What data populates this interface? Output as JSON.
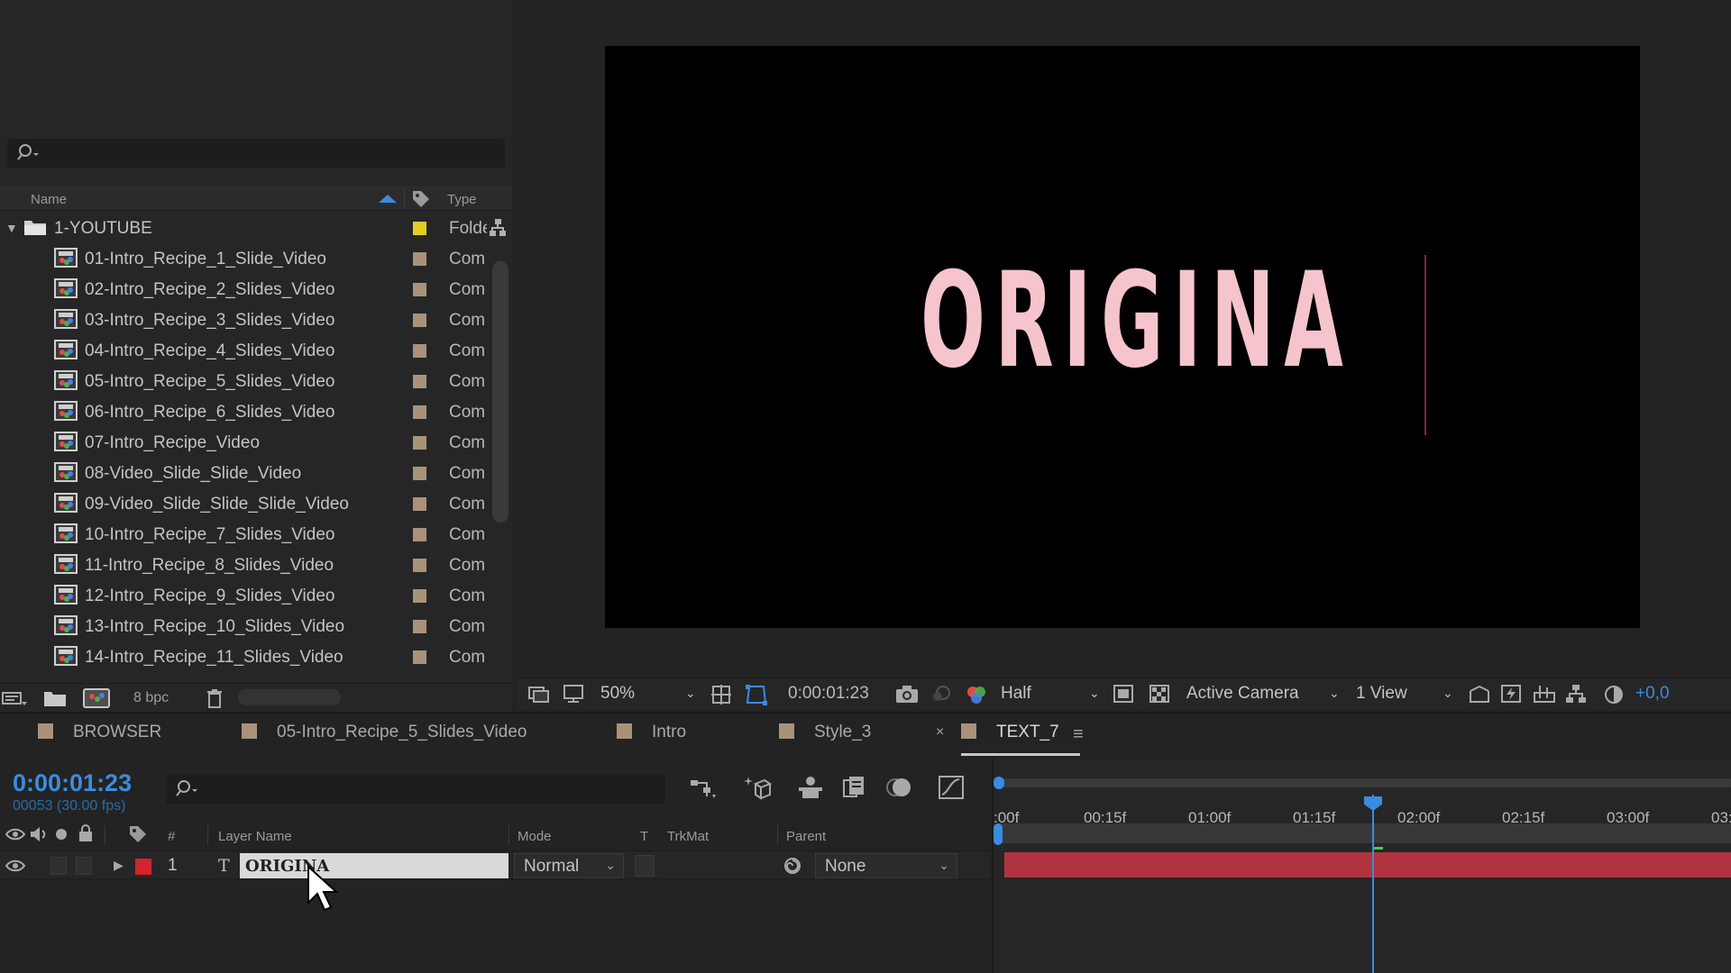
{
  "project": {
    "search_placeholder": "",
    "columns": {
      "name": "Name",
      "type": "Type"
    },
    "folder": {
      "name": "1-YOUTUBE",
      "type": "Folde"
    },
    "items": [
      {
        "name": "01-Intro_Recipe_1_Slide_Video",
        "type": "Com"
      },
      {
        "name": "02-Intro_Recipe_2_Slides_Video",
        "type": "Com"
      },
      {
        "name": "03-Intro_Recipe_3_Slides_Video",
        "type": "Com"
      },
      {
        "name": "04-Intro_Recipe_4_Slides_Video",
        "type": "Com"
      },
      {
        "name": "05-Intro_Recipe_5_Slides_Video",
        "type": "Com"
      },
      {
        "name": "06-Intro_Recipe_6_Slides_Video",
        "type": "Com"
      },
      {
        "name": "07-Intro_Recipe_Video",
        "type": "Com"
      },
      {
        "name": "08-Video_Slide_Slide_Video",
        "type": "Com"
      },
      {
        "name": "09-Video_Slide_Slide_Slide_Video",
        "type": "Com"
      },
      {
        "name": "10-Intro_Recipe_7_Slides_Video",
        "type": "Com"
      },
      {
        "name": "11-Intro_Recipe_8_Slides_Video",
        "type": "Com"
      },
      {
        "name": "12-Intro_Recipe_9_Slides_Video",
        "type": "Com"
      },
      {
        "name": "13-Intro_Recipe_10_Slides_Video",
        "type": "Com"
      },
      {
        "name": "14-Intro_Recipe_11_Slides_Video",
        "type": "Com"
      }
    ],
    "footer": {
      "bpc": "8 bpc"
    }
  },
  "viewer": {
    "canvas_text": "ORIGINA",
    "zoom": "50%",
    "timecode": "0:00:01:23",
    "resolution": "Half",
    "camera": "Active Camera",
    "views": "1 View",
    "exposure": "+0,0"
  },
  "tabs": [
    {
      "label": "BROWSER",
      "active": false
    },
    {
      "label": "05-Intro_Recipe_5_Slides_Video",
      "active": false
    },
    {
      "label": "Intro",
      "active": false
    },
    {
      "label": "Style_3",
      "active": false
    },
    {
      "label": "TEXT_7",
      "active": true
    }
  ],
  "timeline": {
    "current_time": "0:00:01:23",
    "frame_info": "00053 (30.00 fps)",
    "columns": {
      "num": "#",
      "layer_name": "Layer Name",
      "mode": "Mode",
      "t": "T",
      "trkmat": "TrkMat",
      "parent": "Parent"
    },
    "layer": {
      "number": "1",
      "type": "T",
      "name": "ORIGINA",
      "mode": "Normal",
      "parent": "None"
    },
    "ruler_labels": [
      ":00f",
      "00:15f",
      "01:00f",
      "01:15f",
      "02:00f",
      "02:15f",
      "03:00f",
      "03:"
    ],
    "playhead_seconds": 1.767
  },
  "colors": {
    "accent": "#3a8ce0",
    "layer_bar": "#b0343f",
    "label_red": "#d3242f",
    "label_tan": "#a8927a",
    "folder_yellow": "#e3cd24",
    "canvas_text": "#f6c4cc"
  }
}
